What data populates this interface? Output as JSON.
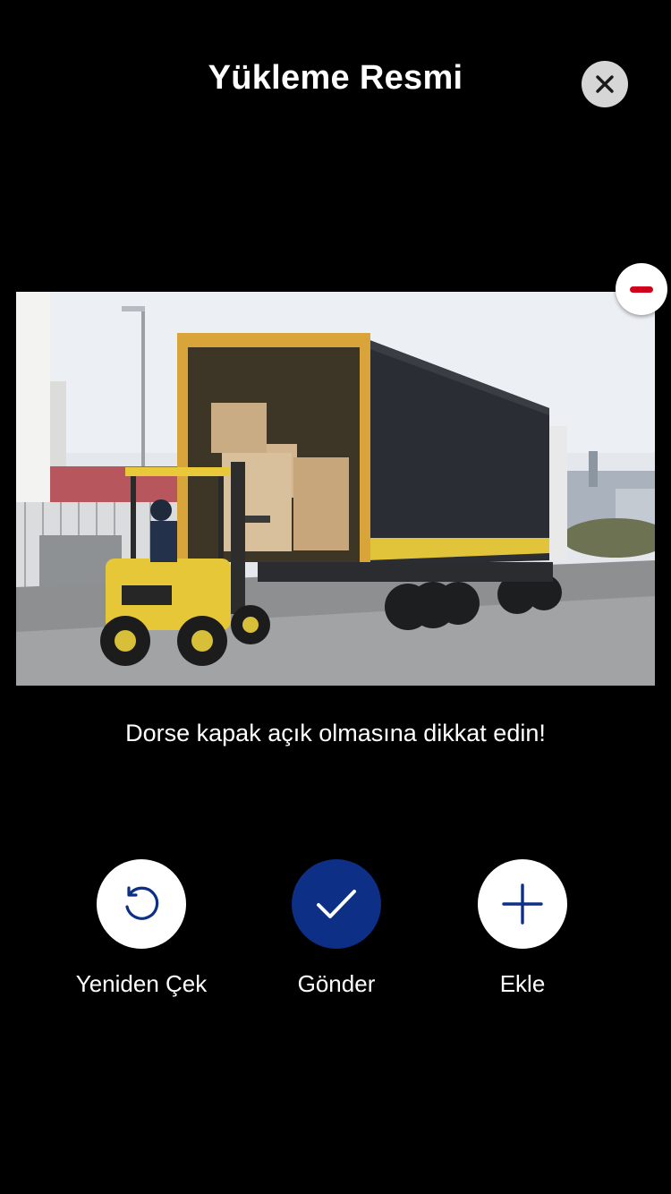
{
  "header": {
    "title": "Yükleme Resmi",
    "close_icon": "close-icon"
  },
  "photo": {
    "description_alt": "Forklift loading boxes into truck trailer",
    "remove_icon": "minus-icon"
  },
  "hint": {
    "text": "Dorse kapak açık olmasına dikkat edin!"
  },
  "actions": [
    {
      "label": "Yeniden Çek",
      "icon": "refresh-icon"
    },
    {
      "label": "Gönder",
      "icon": "check-icon"
    },
    {
      "label": "Ekle",
      "icon": "plus-icon"
    }
  ],
  "colors": {
    "background": "#000000",
    "primary": "#0d2f86",
    "danger": "#d0021b",
    "close_bg": "#d6d6d6"
  }
}
